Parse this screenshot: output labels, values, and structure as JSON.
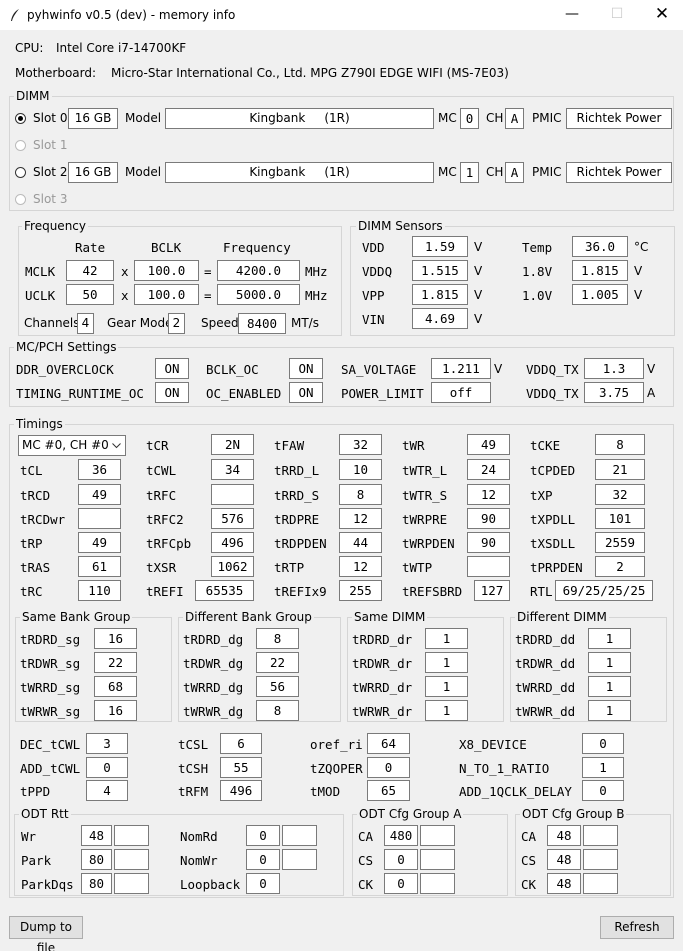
{
  "window": {
    "title": "pyhwinfo v0.5 (dev) - memory info"
  },
  "cpu": {
    "label": "CPU:",
    "value": "Intel Core i7-14700KF"
  },
  "mb": {
    "label": "Motherboard:",
    "value": "Micro-Star International Co., Ltd. MPG Z790I EDGE WIFI (MS-7E03)"
  },
  "dimm": {
    "title": "DIMM",
    "model_label": "Model",
    "mc_label": "MC",
    "ch_label": "CH",
    "pmic_label": "PMIC",
    "slots": [
      {
        "label": "Slot 0",
        "size": "16 GB",
        "model": "Kingbank     (1R)",
        "mc": "0",
        "ch": "A",
        "pmic": "Richtek Power"
      },
      {
        "label": "Slot 1"
      },
      {
        "label": "Slot 2",
        "size": "16 GB",
        "model": "Kingbank     (1R)",
        "mc": "1",
        "ch": "A",
        "pmic": "Richtek Power"
      },
      {
        "label": "Slot 3"
      }
    ]
  },
  "freq": {
    "title": "Frequency",
    "h_rate": "Rate",
    "h_bclk": "BCLK",
    "h_freq": "Frequency",
    "mclk": {
      "label": "MCLK",
      "rate": "42",
      "bclk": "100.0",
      "freq": "4200.0"
    },
    "uclk": {
      "label": "UCLK",
      "rate": "50",
      "bclk": "100.0",
      "freq": "5000.0"
    },
    "x": "x",
    "eq": "=",
    "mhz": "MHz",
    "channels_label": "Channels",
    "channels": "4",
    "gear_label": "Gear Mode",
    "gear": "2",
    "speed_label": "Speed",
    "speed": "8400",
    "speed_unit": "MT/s"
  },
  "sensors": {
    "title": "DIMM Sensors",
    "vdd": {
      "label": "VDD",
      "value": "1.59",
      "unit": "V"
    },
    "vddq": {
      "label": "VDDQ",
      "value": "1.515",
      "unit": "V"
    },
    "vpp": {
      "label": "VPP",
      "value": "1.815",
      "unit": "V"
    },
    "vin": {
      "label": "VIN",
      "value": "4.69",
      "unit": "V"
    },
    "temp": {
      "label": "Temp",
      "value": "36.0",
      "unit": "°C"
    },
    "v18": {
      "label": "1.8V",
      "value": "1.815",
      "unit": "V"
    },
    "v10": {
      "label": "1.0V",
      "value": "1.005",
      "unit": "V"
    }
  },
  "mcpch": {
    "title": "MC/PCH Settings",
    "ddr_oc": {
      "label": "DDR_OVERCLOCK",
      "value": "ON"
    },
    "bclk_oc": {
      "label": "BCLK_OC",
      "value": "ON"
    },
    "sa_v": {
      "label": "SA_VOLTAGE",
      "value": "1.211",
      "unit": "V"
    },
    "vddq_tx_v": {
      "label": "VDDQ_TX",
      "value": "1.3",
      "unit": "V"
    },
    "trt_oc": {
      "label": "TIMING_RUNTIME_OC",
      "value": "ON"
    },
    "oc_en": {
      "label": "OC_ENABLED",
      "value": "ON"
    },
    "pl": {
      "label": "POWER_LIMIT",
      "value": "off"
    },
    "vddq_tx_a": {
      "label": "VDDQ_TX",
      "value": "3.75",
      "unit": "A"
    }
  },
  "timings": {
    "title": "Timings",
    "selector": "MC #0, CH #0",
    "items": [
      {
        "l": "tCR",
        "v": "2N"
      },
      {
        "l": "tFAW",
        "v": "32"
      },
      {
        "l": "tWR",
        "v": "49"
      },
      {
        "l": "tCKE",
        "v": "8"
      },
      {
        "l": "tCL",
        "v": "36"
      },
      {
        "l": "tCWL",
        "v": "34"
      },
      {
        "l": "tRRD_L",
        "v": "10"
      },
      {
        "l": "tWTR_L",
        "v": "24"
      },
      {
        "l": "tCPDED",
        "v": "21"
      },
      {
        "l": "tRCD",
        "v": "49"
      },
      {
        "l": "tRFC",
        "v": ""
      },
      {
        "l": "tRRD_S",
        "v": "8"
      },
      {
        "l": "tWTR_S",
        "v": "12"
      },
      {
        "l": "tXP",
        "v": "32"
      },
      {
        "l": "tRCDwr",
        "v": ""
      },
      {
        "l": "tRFC2",
        "v": "576"
      },
      {
        "l": "tRDPRE",
        "v": "12"
      },
      {
        "l": "tWRPRE",
        "v": "90"
      },
      {
        "l": "tXPDLL",
        "v": "101"
      },
      {
        "l": "tRP",
        "v": "49"
      },
      {
        "l": "tRFCpb",
        "v": "496"
      },
      {
        "l": "tRDPDEN",
        "v": "44"
      },
      {
        "l": "tWRPDEN",
        "v": "90"
      },
      {
        "l": "tXSDLL",
        "v": "2559"
      },
      {
        "l": "tRAS",
        "v": "61"
      },
      {
        "l": "tXSR",
        "v": "1062"
      },
      {
        "l": "tRTP",
        "v": "12"
      },
      {
        "l": "tWTP",
        "v": ""
      },
      {
        "l": "tPRPDEN",
        "v": "2"
      },
      {
        "l": "tRC",
        "v": "110"
      },
      {
        "l": "tREFI",
        "v": "65535"
      },
      {
        "l": "tREFIx9",
        "v": "255"
      },
      {
        "l": "tREFSBRD",
        "v": "127"
      },
      {
        "l": "RTL",
        "v": "69/25/25/25"
      }
    ]
  },
  "turn": [
    {
      "title": "Same Bank Group",
      "rows": [
        {
          "l": "tRDRD_sg",
          "v": "16"
        },
        {
          "l": "tRDWR_sg",
          "v": "22"
        },
        {
          "l": "tWRRD_sg",
          "v": "68"
        },
        {
          "l": "tWRWR_sg",
          "v": "16"
        }
      ]
    },
    {
      "title": "Different Bank Group",
      "rows": [
        {
          "l": "tRDRD_dg",
          "v": "8"
        },
        {
          "l": "tRDWR_dg",
          "v": "22"
        },
        {
          "l": "tWRRD_dg",
          "v": "56"
        },
        {
          "l": "tWRWR_dg",
          "v": "8"
        }
      ]
    },
    {
      "title": "Same DIMM",
      "rows": [
        {
          "l": "tRDRD_dr",
          "v": "1"
        },
        {
          "l": "tRDWR_dr",
          "v": "1"
        },
        {
          "l": "tWRRD_dr",
          "v": "1"
        },
        {
          "l": "tWRWR_dr",
          "v": "1"
        }
      ]
    },
    {
      "title": "Different DIMM",
      "rows": [
        {
          "l": "tRDRD_dd",
          "v": "1"
        },
        {
          "l": "tRDWR_dd",
          "v": "1"
        },
        {
          "l": "tWRRD_dd",
          "v": "1"
        },
        {
          "l": "tWRWR_dd",
          "v": "1"
        }
      ]
    }
  ],
  "misc": [
    {
      "l": "DEC_tCWL",
      "v": "3"
    },
    {
      "l": "tCSL",
      "v": "6"
    },
    {
      "l": "oref_ri",
      "v": "64"
    },
    {
      "l": "X8_DEVICE",
      "v": "0"
    },
    {
      "l": "ADD_tCWL",
      "v": "0"
    },
    {
      "l": "tCSH",
      "v": "55"
    },
    {
      "l": "tZQOPER",
      "v": "0"
    },
    {
      "l": "N_TO_1_RATIO",
      "v": "1"
    },
    {
      "l": "tPPD",
      "v": "4"
    },
    {
      "l": "tRFM",
      "v": "496"
    },
    {
      "l": "tMOD",
      "v": "65"
    },
    {
      "l": "ADD_1QCLK_DELAY",
      "v": "0"
    }
  ],
  "odt": {
    "title": "ODT Rtt",
    "wr": {
      "l": "Wr",
      "v": "48",
      "v2": ""
    },
    "park": {
      "l": "Park",
      "v": "80",
      "v2": ""
    },
    "parkdqs": {
      "l": "ParkDqs",
      "v": "80",
      "v2": ""
    },
    "nomrd": {
      "l": "NomRd",
      "v": "0",
      "v2": ""
    },
    "nomwr": {
      "l": "NomWr",
      "v": "0",
      "v2": ""
    },
    "loopback": {
      "l": "Loopback",
      "v": "0"
    }
  },
  "cfga": {
    "title": "ODT Cfg Group A",
    "ca": {
      "l": "CA",
      "v": "480",
      "v2": ""
    },
    "cs": {
      "l": "CS",
      "v": "0",
      "v2": ""
    },
    "ck": {
      "l": "CK",
      "v": "0",
      "v2": ""
    }
  },
  "cfgb": {
    "title": "ODT Cfg Group B",
    "ca": {
      "l": "CA",
      "v": "48",
      "v2": ""
    },
    "cs": {
      "l": "CS",
      "v": "48",
      "v2": ""
    },
    "ck": {
      "l": "CK",
      "v": "48",
      "v2": ""
    }
  },
  "buttons": {
    "dump": "Dump to file",
    "refresh": "Refresh"
  }
}
